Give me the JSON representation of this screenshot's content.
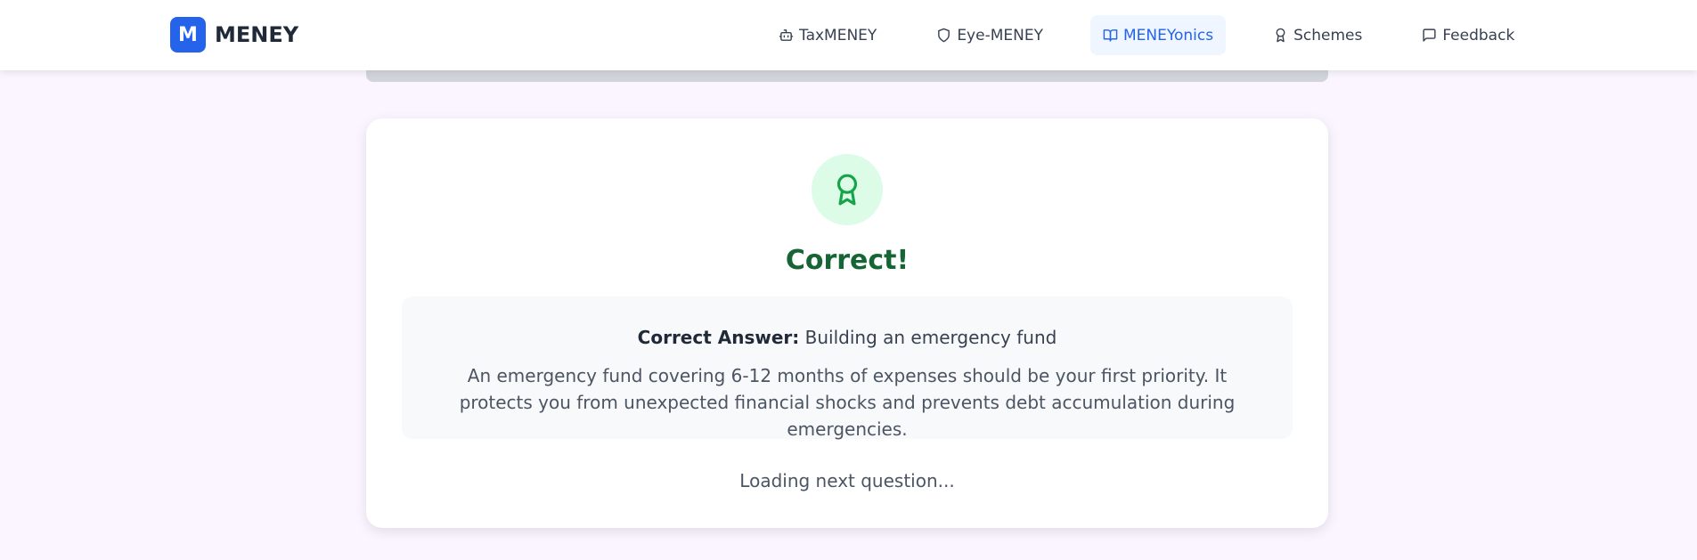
{
  "brand": {
    "logo_letter": "M",
    "name": "MENEY",
    "color": "#2563eb"
  },
  "nav": {
    "items": [
      {
        "label": "TaxMENEY",
        "icon": "robot-icon"
      },
      {
        "label": "Eye-MENEY",
        "icon": "shield-icon"
      },
      {
        "label": "MENEYonics",
        "icon": "book-open-icon",
        "active": true
      },
      {
        "label": "Schemes",
        "icon": "award-icon"
      },
      {
        "label": "Feedback",
        "icon": "message-square-icon"
      }
    ]
  },
  "result": {
    "icon": "award-icon",
    "title": "Correct!",
    "title_color": "#166534",
    "answer_label": "Correct Answer:",
    "answer_value": "Building an emergency fund",
    "explanation": "An emergency fund covering 6-12 months of expenses should be your first priority. It protects you from unexpected financial shocks and prevents debt accumulation during emergencies.",
    "loading_text": "Loading next question..."
  }
}
